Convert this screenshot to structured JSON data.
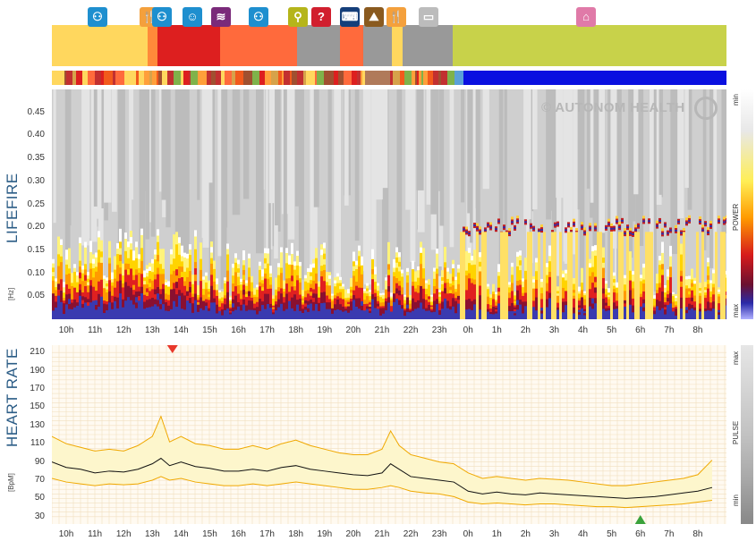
{
  "panels": {
    "spectrogram_title": "LIFEFIRE",
    "spectrogram_unit": "[Hz]",
    "hr_title": "HEART RATE",
    "hr_unit": "[BpM]",
    "watermark": "© AUTONOM HEALTH"
  },
  "legend": {
    "spectrogram": {
      "min": "min",
      "mid": "POWER",
      "max": "max"
    },
    "hr": {
      "max": "max",
      "mid": "PULSE",
      "min": "min"
    }
  },
  "colors": {
    "sleep": "#c8d24a",
    "work_yellow": "#ffd75e",
    "red": "#dd1f1f",
    "orange": "#ff6a3c",
    "grey": "#999999",
    "hr_line": "#111111",
    "hr_band": "#f0a800",
    "hr_range_fill": "#fdf6cc",
    "spectro_bg": "#cfcfcf"
  },
  "activity_icons": [
    {
      "name": "meeting-icon",
      "color": "#1e8fcf",
      "glyph": "⚇"
    },
    {
      "name": "meal-icon",
      "color": "#f4a03c",
      "glyph": "🍴"
    },
    {
      "name": "meeting-icon",
      "color": "#1e8fcf",
      "glyph": "⚇"
    },
    {
      "name": "thinking-icon",
      "color": "#1e8fcf",
      "glyph": "☺"
    },
    {
      "name": "reading-icon",
      "color": "#7a2a7a",
      "glyph": "≋"
    },
    {
      "name": "meeting-icon",
      "color": "#1e8fcf",
      "glyph": "⚇"
    },
    {
      "name": "walking-icon",
      "color": "#b5b51a",
      "glyph": "⚲"
    },
    {
      "name": "unknown-icon",
      "color": "#d11f2e",
      "glyph": "?"
    },
    {
      "name": "computer-icon",
      "color": "#153f7a",
      "glyph": "⌨"
    },
    {
      "name": "hiking-icon",
      "color": "#8a5a1f",
      "glyph": "⛰"
    },
    {
      "name": "meal-icon",
      "color": "#f4a03c",
      "glyph": "🍴"
    },
    {
      "name": "screen-icon",
      "color": "#bcbcbc",
      "glyph": "▭"
    },
    {
      "name": "sleep-icon",
      "color": "#e07aa8",
      "glyph": "⌂"
    }
  ],
  "chart_data": [
    {
      "type": "heatmap",
      "title": "LIFEFIRE",
      "ylabel": "[Hz]",
      "ylim": [
        0,
        0.5
      ],
      "yticks": [
        "0.05",
        "0.10",
        "0.15",
        "0.20",
        "0.25",
        "0.30",
        "0.35",
        "0.40",
        "0.45"
      ],
      "xticks": [
        "10h",
        "11h",
        "12h",
        "13h",
        "14h",
        "15h",
        "16h",
        "17h",
        "18h",
        "19h",
        "20h",
        "21h",
        "22h",
        "23h",
        "0h",
        "1h",
        "2h",
        "3h",
        "4h",
        "5h",
        "6h",
        "7h",
        "8h"
      ],
      "colorbar": "POWER",
      "notes": "high power in 0–0.15 Hz band through daytime; narrow band near 0.20 Hz from 0h to 8h"
    },
    {
      "type": "line",
      "title": "HEART RATE",
      "ylabel": "[BpM]",
      "ylim": [
        22,
        218
      ],
      "yticks": [
        30,
        50,
        70,
        90,
        110,
        130,
        150,
        170,
        190,
        210
      ],
      "xticks": [
        "10h",
        "11h",
        "12h",
        "13h",
        "14h",
        "15h",
        "16h",
        "17h",
        "18h",
        "19h",
        "20h",
        "21h",
        "22h",
        "23h",
        "0h",
        "1h",
        "2h",
        "3h",
        "4h",
        "5h",
        "6h",
        "7h",
        "8h"
      ],
      "x_hours": [
        9.5,
        10,
        10.5,
        11,
        11.5,
        12,
        12.5,
        13,
        13.3,
        13.6,
        14,
        14.5,
        15,
        15.5,
        16,
        16.5,
        17,
        17.5,
        18,
        18.5,
        19,
        19.5,
        20,
        20.5,
        21,
        21.3,
        21.6,
        22,
        22.5,
        23,
        23.5,
        0,
        0.5,
        1,
        1.5,
        2,
        2.5,
        3,
        3.5,
        4,
        4.5,
        5,
        5.5,
        6,
        6.5,
        7,
        7.5,
        8,
        8.5
      ],
      "series": [
        {
          "name": "average",
          "values": [
            90,
            84,
            82,
            78,
            80,
            79,
            82,
            88,
            94,
            86,
            90,
            85,
            83,
            80,
            80,
            82,
            80,
            84,
            86,
            82,
            80,
            78,
            76,
            75,
            78,
            88,
            82,
            74,
            72,
            70,
            68,
            58,
            55,
            57,
            55,
            54,
            56,
            55,
            54,
            53,
            52,
            51,
            50,
            51,
            52,
            54,
            56,
            58,
            62
          ]
        },
        {
          "name": "upper",
          "values": [
            118,
            110,
            106,
            102,
            104,
            102,
            108,
            118,
            140,
            112,
            118,
            110,
            108,
            104,
            104,
            108,
            104,
            110,
            114,
            108,
            104,
            100,
            98,
            98,
            104,
            124,
            108,
            98,
            94,
            90,
            88,
            78,
            72,
            74,
            72,
            70,
            72,
            71,
            70,
            68,
            66,
            64,
            64,
            66,
            68,
            70,
            72,
            76,
            92
          ]
        },
        {
          "name": "lower",
          "values": [
            72,
            68,
            66,
            64,
            66,
            65,
            66,
            70,
            74,
            70,
            72,
            68,
            66,
            64,
            64,
            66,
            64,
            66,
            68,
            66,
            64,
            62,
            60,
            60,
            62,
            64,
            62,
            58,
            56,
            55,
            52,
            46,
            44,
            45,
            44,
            43,
            44,
            44,
            43,
            42,
            41,
            41,
            40,
            41,
            42,
            43,
            44,
            46,
            48
          ]
        }
      ],
      "markers": [
        {
          "label": "max",
          "x_hour": 13.7,
          "color": "#e8382b"
        },
        {
          "label": "min",
          "x_hour": 6.0,
          "color": "#3aa23a"
        }
      ]
    }
  ]
}
